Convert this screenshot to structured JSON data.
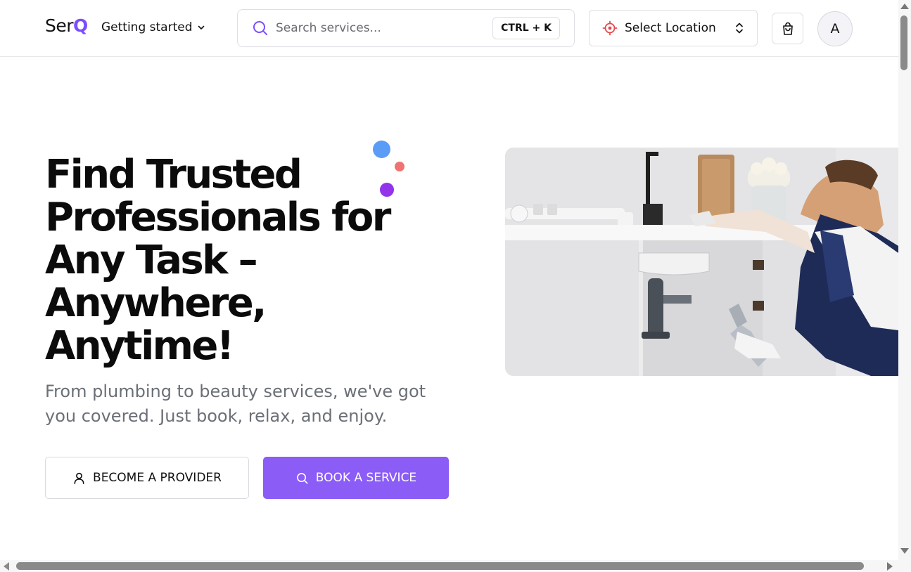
{
  "header": {
    "logo_prefix": "Ser",
    "logo_accent": "Q",
    "menu_label": "Getting started",
    "search_placeholder": "Search services...",
    "search_shortcut": "CTRL + K",
    "location_label": "Select Location",
    "avatar_initial": "A"
  },
  "hero": {
    "headline": "Find Trusted Professionals for Any Task – Anywhere, Anytime!",
    "subtitle": "From plumbing to beauty services, we've got you covered. Just book, relax, and enjoy.",
    "provider_button": "BECOME A PROVIDER",
    "book_button": "BOOK A SERVICE",
    "image_subject": "plumber repairing kitchen sink"
  },
  "icons": {
    "menu_chevron": "chevron-down-icon",
    "search": "search-icon",
    "location": "location-target-icon",
    "location_toggle": "chevron-up-down-icon",
    "cart": "shopping-bag-icon",
    "provider": "user-icon",
    "book": "search-icon"
  },
  "colors": {
    "brand": "#8b5cf6",
    "logo_accent": "#7c4dff",
    "location_icon": "#e5484d",
    "dot_blue": "#5b9cf7",
    "dot_red": "#f07373",
    "dot_purple": "#9333ea"
  }
}
